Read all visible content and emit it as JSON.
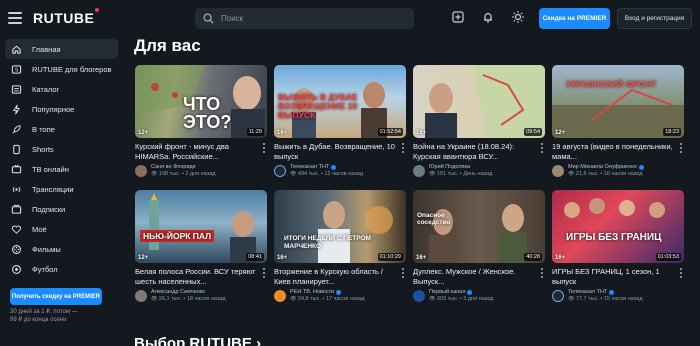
{
  "header": {
    "logo": "RUTUBE",
    "search_placeholder": "Поиск",
    "premier_button": "Скидка на PREMIER",
    "login_button": "Вход и регистрация"
  },
  "sidebar": {
    "items": [
      {
        "label": "Главная",
        "icon": "home-icon"
      },
      {
        "label": "RUTUBE для блогеров",
        "icon": "studio-icon"
      },
      {
        "label": "Каталог",
        "icon": "catalog-icon"
      },
      {
        "label": "Популярное",
        "icon": "popular-icon"
      },
      {
        "label": "В топе",
        "icon": "rocket-icon"
      },
      {
        "label": "Shorts",
        "icon": "shorts-icon"
      },
      {
        "label": "ТВ онлайн",
        "icon": "tv-icon"
      },
      {
        "label": "Трансляции",
        "icon": "broadcast-icon"
      },
      {
        "label": "Подписки",
        "icon": "subscriptions-icon"
      },
      {
        "label": "Моё",
        "icon": "my-icon"
      },
      {
        "label": "Фильмы",
        "icon": "films-icon"
      },
      {
        "label": "Футбол",
        "icon": "football-icon"
      }
    ],
    "promo_button": "Получить скидку на PREMIER",
    "promo_text_1": "30 дней за 1 ₽, потом —",
    "promo_text_2": "99 ₽ до конца осени"
  },
  "main": {
    "section_title": "Для вас",
    "next_section_title": "Выбор RUTUBE ›",
    "cards": [
      {
        "title": "Курский фронт - минус два HIMARSа. Российские...",
        "channel": "Саня во Флориде",
        "views": "198 тыс.",
        "time": "2 дня назад",
        "age": "12+",
        "duration": "11:29",
        "caption": "ЧТО ЭТО?"
      },
      {
        "title": "Выжить в Дубае. Возвращение, 10 выпуск",
        "channel": "Телеканал ТНТ",
        "views": "494 тыс.",
        "time": "12 часов назад",
        "age": "16+",
        "duration": "01:52:54",
        "caption": "ВЫЖИТЬ В ДУБАЕ ВОЗВРАЩЕНИЕ 10 ВЫПУСК"
      },
      {
        "title": "Война на Украине (18.08.24): Курская авантюра ВСУ...",
        "channel": "Юрий Подоляка",
        "views": "151 тыс.",
        "time": "День назад",
        "age": "16+",
        "duration": "09:54",
        "caption": ""
      },
      {
        "title": "19 августа (видео в понедельники, мама...",
        "channel": "Мир Михаила Онуфриенко",
        "views": "21,6 тыс.",
        "time": "16 часов назад",
        "age": "12+",
        "duration": "18:23",
        "caption": "УКРАИНСКИЙ ФРОНТ"
      },
      {
        "title": "Белая полоса России. ВСУ теряют шесть населенных...",
        "channel": "Александр Семченко",
        "views": "26,1 тыс.",
        "time": "18 часов назад",
        "age": "12+",
        "duration": "08:41",
        "caption": "НЬЮ-ЙОРК ПАЛ"
      },
      {
        "title": "Вторжение в Курскую область / Киев планирует...",
        "channel": "РЕН ТВ. Новости",
        "views": "24,8 тыс.",
        "time": "17 часов назад",
        "age": "16+",
        "duration": "01:10:29",
        "caption": "ИТОГИ НЕДЕЛИ С ПЕТРОМ МАРЧЕНКО"
      },
      {
        "title": "Дуплекс. Мужское / Женское. Выпуск...",
        "channel": "Первый канал",
        "views": "303 тыс.",
        "time": "3 дня назад",
        "age": "16+",
        "duration": "40:28",
        "caption": "Опасное соседство"
      },
      {
        "title": "ИГРЫ БЕЗ ГРАНИЦ, 1 сезон, 1 выпуск",
        "channel": "Телеканал ТНТ",
        "views": "77,7 тыс.",
        "time": "15 часов назад",
        "age": "16+",
        "duration": "01:03:53",
        "caption": "ИГРЫ БЕЗ ГРАНИЦ"
      }
    ]
  }
}
